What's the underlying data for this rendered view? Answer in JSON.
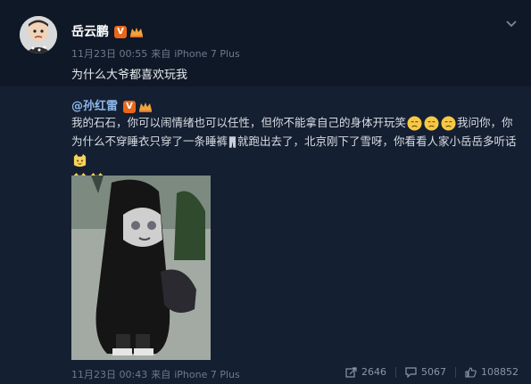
{
  "post": {
    "author": "岳云鹏",
    "verified_badge": "V",
    "time": "11月23日 00:55",
    "from_label": "来自",
    "device": "iPhone 7 Plus",
    "text": "为什么大爷都喜欢玩我"
  },
  "retweet": {
    "author": "@孙红雷",
    "verified_badge": "V",
    "text_part1": "我的石石，你可以闹情绪也可以任性，但你不能拿自己的身体开玩笑",
    "text_part2": "我问你，你为什么不穿睡衣只穿了一条睡裤",
    "text_part3": "就跑出去了，北京刚下了雪呀，你看看人家小岳岳多听话",
    "time": "11月23日 00:43",
    "from_label": "来自",
    "device": "iPhone 7 Plus",
    "shares": "2646",
    "comments": "5067",
    "likes": "108852"
  },
  "icons": {
    "emoji_sad": "sad-face-emoji",
    "emoji_cat": "cat-face-emoji",
    "share": "share-icon",
    "comment": "comment-icon",
    "like": "thumbs-up-icon",
    "menu": "chevron-down-icon"
  },
  "colors": {
    "background": "#0d1521",
    "retweet_background": "#141f31",
    "link": "#8fb7e8",
    "verified": "#e8671a"
  }
}
